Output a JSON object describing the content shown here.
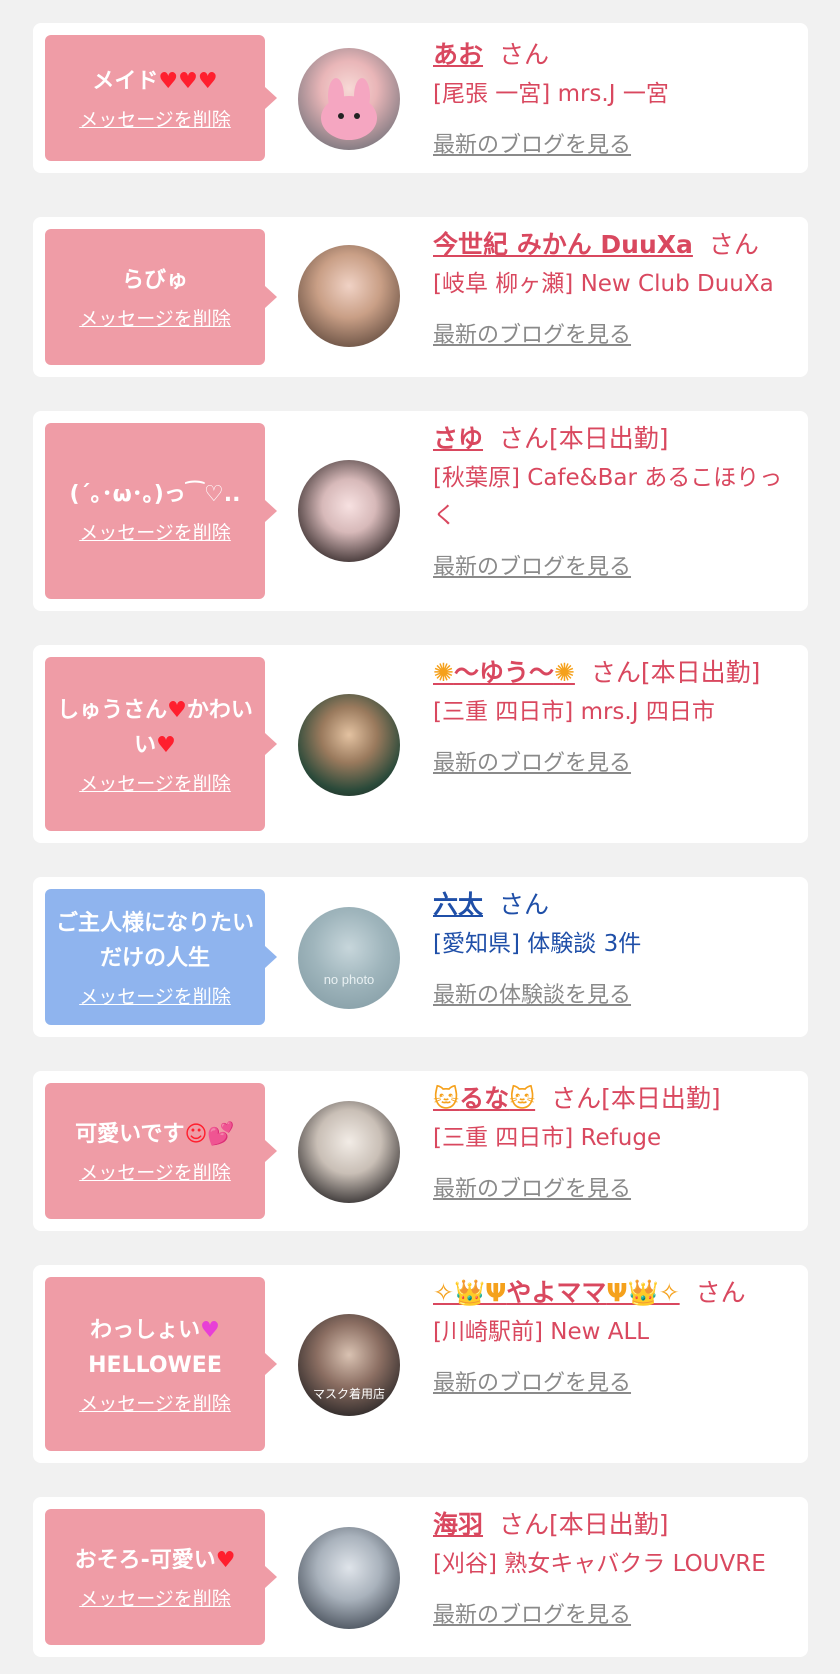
{
  "messages": [
    {
      "bubble": "メイド",
      "bubble_suffix": "♥♥♥",
      "delete": "メッセージを削除",
      "name": "あお",
      "suffix": "さん",
      "store": "[尾張 一宮] mrs.J 一宮",
      "blog": "最新のブログを見る"
    },
    {
      "bubble": "らびゅ",
      "delete": "メッセージを削除",
      "name": "今世紀 みかん DuuXa",
      "suffix": "さん",
      "store": "[岐阜 柳ヶ瀬] New Club DuuXa",
      "blog": "最新のブログを見る"
    },
    {
      "bubble": "(´｡･ω･｡)っ⁀♡..",
      "delete": "メッセージを削除",
      "name": "さゆ",
      "suffix": "さん[本日出勤]",
      "store": "[秋葉原] Cafe&Bar あるこほりっく",
      "blog": "最新のブログを見る"
    },
    {
      "bubble": "しゅうさん",
      "bubble_mid": "♥",
      "bubble_end": "かわいい",
      "bubble_suffix": "♥",
      "delete": "メッセージを削除",
      "name": "〜ゆう〜",
      "name_deco": "✺",
      "suffix": "さん[本日出勤]",
      "store": "[三重 四日市] mrs.J 四日市",
      "blog": "最新のブログを見る"
    },
    {
      "bubble": "ご主人様になりたいだけの人生",
      "delete": "メッセージを削除",
      "avatar_text": "no photo",
      "name": "六太",
      "suffix": "さん",
      "store": "[愛知県] 体験談 3件",
      "blog": "最新の体験談を見る"
    },
    {
      "bubble": "可愛いです",
      "bubble_suffix": "☺💕",
      "delete": "メッセージを削除",
      "name": "るな",
      "name_deco": "🐱",
      "suffix": "さん[本日出勤]",
      "store": "[三重 四日市] Refuge",
      "blog": "最新のブログを見る"
    },
    {
      "bubble": "わっしょい",
      "bubble_suffix": "♥",
      "bubble_end": "HELLOWEE",
      "delete": "メッセージを削除",
      "avatar_text": "マスク着用店",
      "name": "やよママ",
      "name_deco": "✧👑Ψ",
      "name_deco_end": "Ψ👑✧",
      "suffix": "さん",
      "store": "[川崎駅前] New ALL",
      "blog": "最新のブログを見る"
    },
    {
      "bubble": "おそろ-可愛い",
      "bubble_suffix": "♥",
      "delete": "メッセージを削除",
      "name": "海羽",
      "suffix": "さん[本日出勤]",
      "store": "[刈谷] 熟女キャバクラ LOUVRE",
      "blog": "最新のブログを見る"
    }
  ],
  "colors": {
    "pink": "#ef9ca6",
    "blue": "#8fb4ee",
    "name_pink": "#d9485f",
    "name_blue": "#1f4fa8",
    "link_gray": "#8a8a8a"
  }
}
